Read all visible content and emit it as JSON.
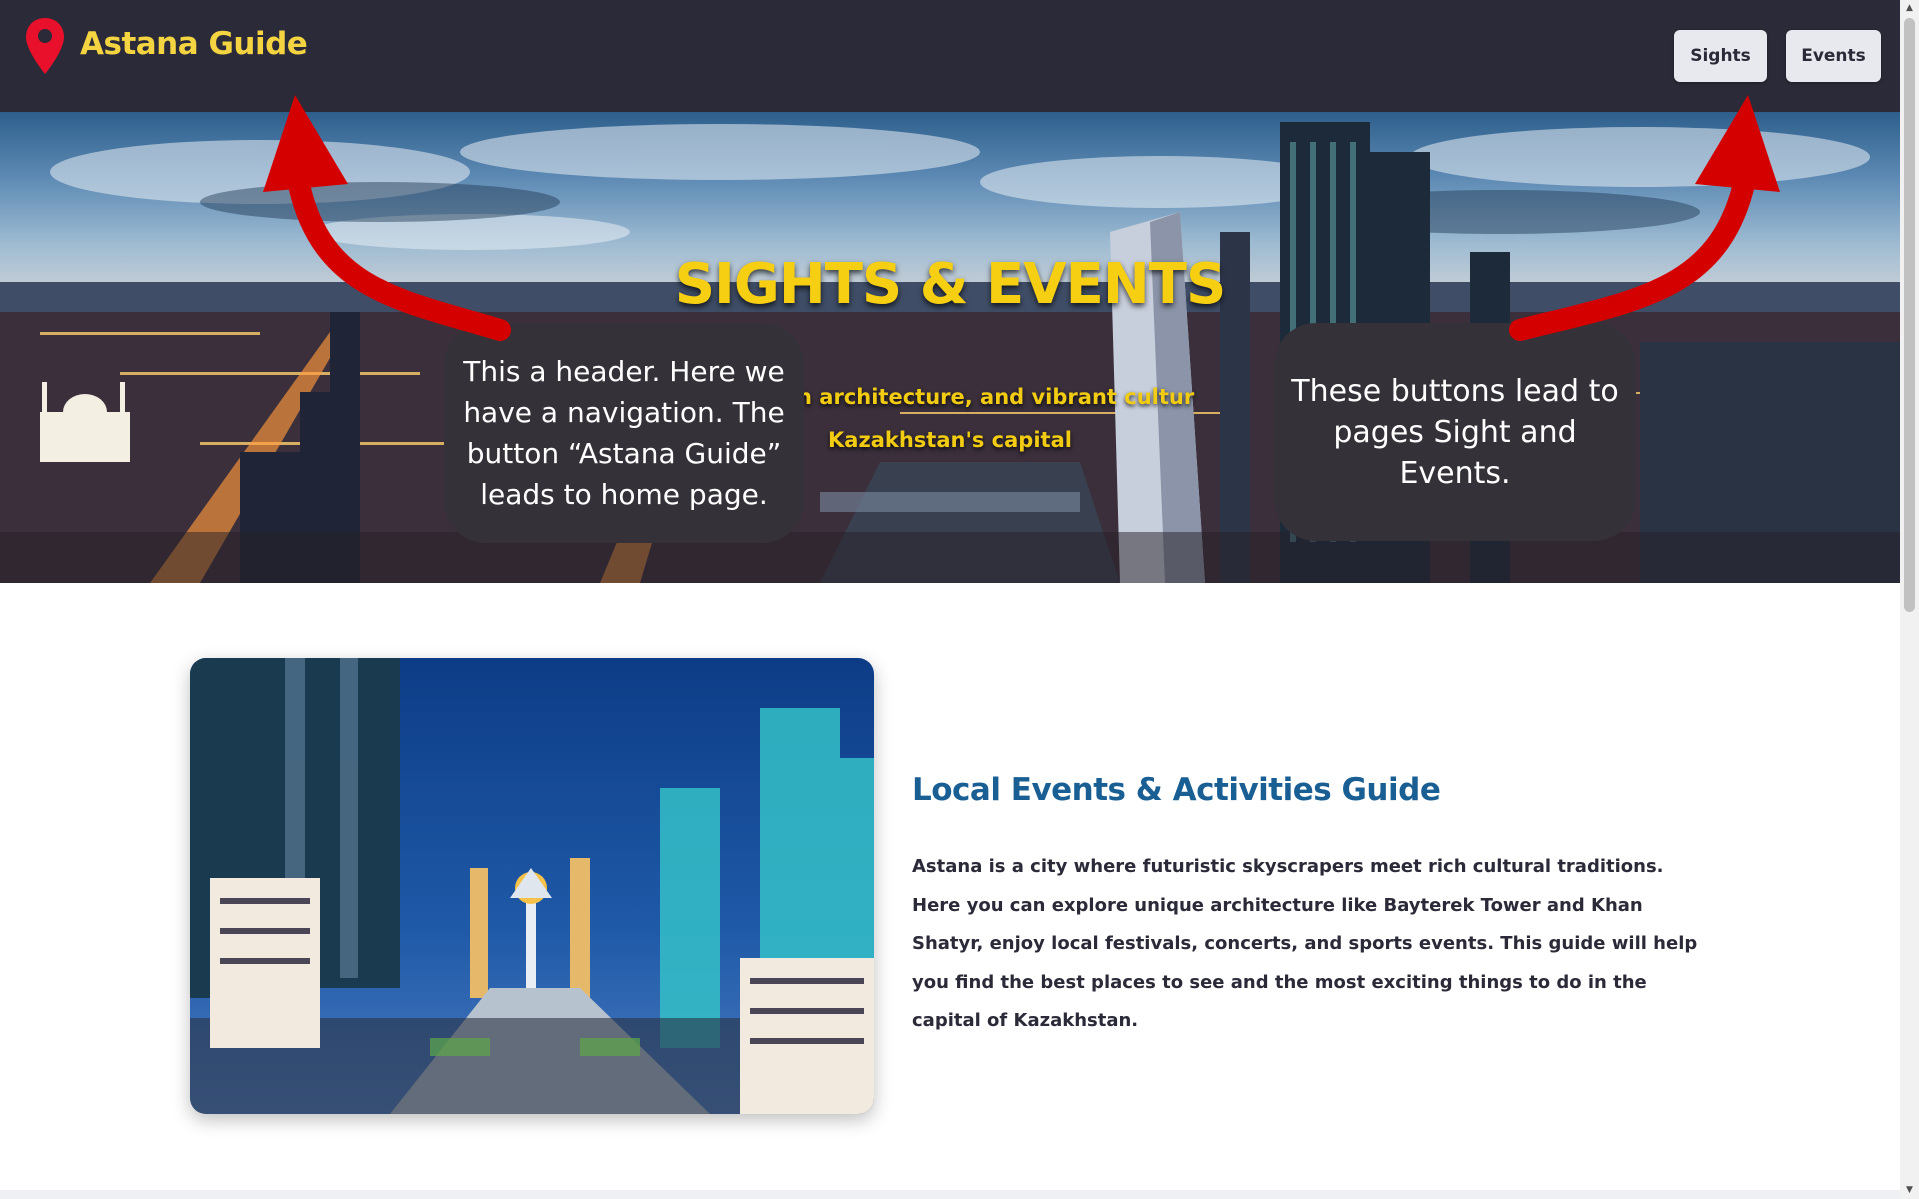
{
  "header": {
    "brand": "Astana Guide",
    "nav": [
      {
        "label": "Sights"
      },
      {
        "label": "Events"
      }
    ]
  },
  "hero": {
    "title": "SIGHTS & EVENTS",
    "subtitle_line1": ", modern architecture, and vibrant cultur",
    "subtitle_line2": "Kazakhstan's capital"
  },
  "annotations": {
    "left": "This a header. Here we have a navigation. The button “Astana Guide” leads to home page.",
    "right": "These buttons lead to pages Sight and Events."
  },
  "section": {
    "title": "Local Events & Activities Guide",
    "text": "Astana is a city where futuristic skyscrapers meet rich cultural traditions. Here you can explore unique architecture like Bayterek Tower and Khan Shatyr, enjoy local festivals, concerts, and sports events. This guide will help you find the best places to see and the most exciting things to do in the capital of Kazakhstan."
  },
  "colors": {
    "header_bg": "#2b2a38",
    "brand_yellow": "#f5d442",
    "pin_red": "#e8102a",
    "arrow_red": "#d40000",
    "section_title_blue": "#1a5f94",
    "bubble_bg": "#353139"
  },
  "icons": [
    "location-pin-icon",
    "arrow-left-icon",
    "arrow-right-icon",
    "scroll-up-icon",
    "scroll-down-icon"
  ]
}
